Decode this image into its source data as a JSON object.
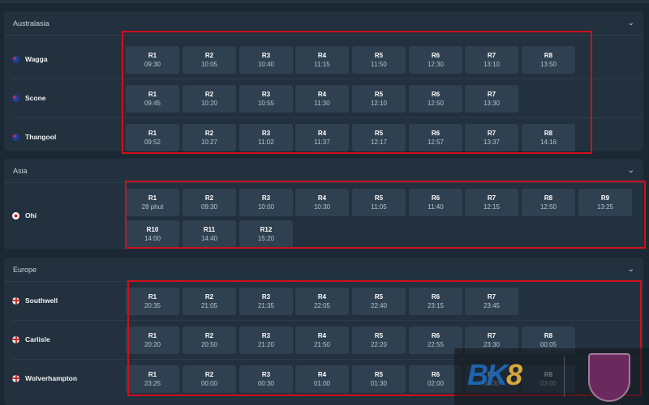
{
  "sections": [
    {
      "title": "Australasia",
      "venues": [
        {
          "name": "Wagga",
          "flag": "au",
          "races": [
            [
              "R1",
              "09:30"
            ],
            [
              "R2",
              "10:05"
            ],
            [
              "R3",
              "10:40"
            ],
            [
              "R4",
              "11:15"
            ],
            [
              "R5",
              "11:50"
            ],
            [
              "R6",
              "12:30"
            ],
            [
              "R7",
              "13:10"
            ],
            [
              "R8",
              "13:50"
            ]
          ]
        },
        {
          "name": "Scone",
          "flag": "au",
          "races": [
            [
              "R1",
              "09:45"
            ],
            [
              "R2",
              "10:20"
            ],
            [
              "R3",
              "10:55"
            ],
            [
              "R4",
              "11:30"
            ],
            [
              "R5",
              "12:10"
            ],
            [
              "R6",
              "12:50"
            ],
            [
              "R7",
              "13:30"
            ]
          ]
        },
        {
          "name": "Thangool",
          "flag": "au",
          "races": [
            [
              "R1",
              "09:52"
            ],
            [
              "R2",
              "10:27"
            ],
            [
              "R3",
              "11:02"
            ],
            [
              "R4",
              "11:37"
            ],
            [
              "R5",
              "12:17"
            ],
            [
              "R6",
              "12:57"
            ],
            [
              "R7",
              "13:37"
            ],
            [
              "R8",
              "14:16"
            ]
          ]
        }
      ]
    },
    {
      "title": "Asia",
      "venues": [
        {
          "name": "Ohi",
          "flag": "jp",
          "races": [
            [
              "R1",
              "28 phut"
            ],
            [
              "R2",
              "09:30"
            ],
            [
              "R3",
              "10:00"
            ],
            [
              "R4",
              "10:30"
            ],
            [
              "R5",
              "11:05"
            ],
            [
              "R6",
              "11:40"
            ],
            [
              "R7",
              "12:15"
            ],
            [
              "R8",
              "12:50"
            ],
            [
              "R9",
              "13:25"
            ],
            [
              "R10",
              "14:00"
            ],
            [
              "R11",
              "14:40"
            ],
            [
              "R12",
              "15:20"
            ]
          ]
        }
      ]
    },
    {
      "title": "Europe",
      "venues": [
        {
          "name": "Southwell",
          "flag": "gb",
          "races": [
            [
              "R1",
              "20:35"
            ],
            [
              "R2",
              "21:05"
            ],
            [
              "R3",
              "21:35"
            ],
            [
              "R4",
              "22:05"
            ],
            [
              "R5",
              "22:40"
            ],
            [
              "R6",
              "23:15"
            ],
            [
              "R7",
              "23:45"
            ]
          ]
        },
        {
          "name": "Carlisle",
          "flag": "gb",
          "races": [
            [
              "R1",
              "20:20"
            ],
            [
              "R2",
              "20:50"
            ],
            [
              "R3",
              "21:20"
            ],
            [
              "R4",
              "21:50"
            ],
            [
              "R5",
              "22:20"
            ],
            [
              "R6",
              "22:55"
            ],
            [
              "R7",
              "23:30"
            ],
            [
              "R8",
              "00:05"
            ]
          ]
        },
        {
          "name": "Wolverhampton",
          "flag": "gb",
          "races": [
            [
              "R1",
              "23:25"
            ],
            [
              "R2",
              "00:00"
            ],
            [
              "R3",
              "00:30"
            ],
            [
              "R4",
              "01:00"
            ],
            [
              "R5",
              "01:30"
            ],
            [
              "R6",
              "02:00"
            ],
            [
              "R7",
              "02:30"
            ],
            [
              "R8",
              "03:00"
            ]
          ]
        }
      ]
    }
  ],
  "watermark": {
    "logo_text": "BK8"
  },
  "colors": {
    "highlight": "#d0101c",
    "tile": "#2f4050"
  }
}
